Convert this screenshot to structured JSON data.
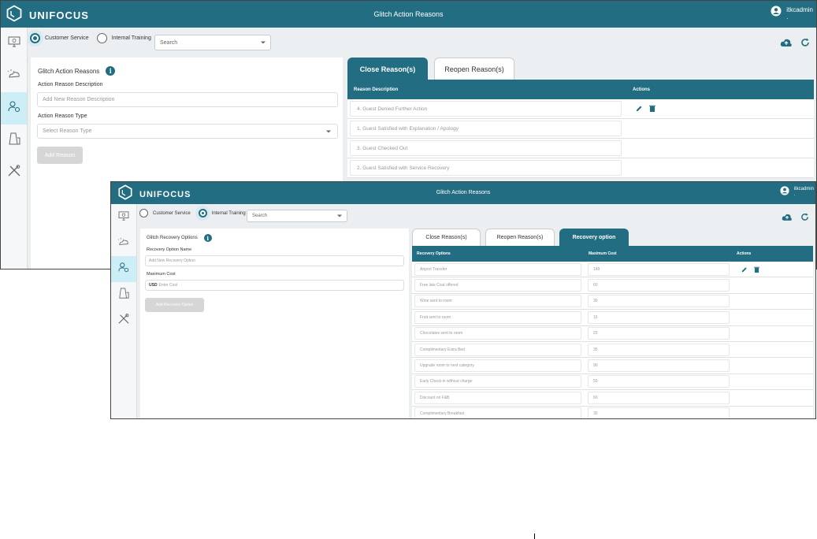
{
  "brand": "UNIFOCUS",
  "colors": {
    "primary": "#236d82",
    "sidebar_active": "#cdeef7",
    "disabled": "#d6d6d6"
  },
  "icons": [
    "unifocus-logo-icon",
    "user-circle-icon",
    "monitor-icon",
    "weather-icon",
    "user-settings-icon",
    "cleaning-icon",
    "tools-icon",
    "cloud-upload-icon",
    "refresh-icon",
    "info-icon",
    "edit-icon",
    "delete-icon",
    "chevron-down-icon"
  ],
  "window1": {
    "title": "Glitch Action Reasons",
    "user": {
      "name": "itkcadmin",
      "sub": "."
    },
    "radios": [
      {
        "label": "Customer Service",
        "selected": true
      },
      {
        "label": "Internal Training",
        "selected": false
      }
    ],
    "search_placeholder": "Search",
    "form": {
      "heading": "Glitch Action Reasons",
      "desc_label": "Action Reason Description",
      "desc_placeholder": "Add New Reason Description",
      "type_label": "Action Reason Type",
      "type_placeholder": "Select Reason Type",
      "add_button": "Add Reason"
    },
    "tabs": [
      {
        "label": "Close Reason(s)",
        "active": true
      },
      {
        "label": "Reopen Reason(s)",
        "active": false
      }
    ],
    "columns": [
      "Reason Description",
      "Actions"
    ],
    "rows": [
      {
        "desc": "4. Guest Denied Further Action"
      },
      {
        "desc": "1. Guest Satisfied with Explanation / Apology"
      },
      {
        "desc": "3. Guest Checked Out"
      },
      {
        "desc": "2. Guest Satisfied with Service Recovery"
      }
    ]
  },
  "window2": {
    "title": "Glitch Action Reasons",
    "user": {
      "name": "itkcadmin",
      "sub": "."
    },
    "radios": [
      {
        "label": "Customer Service",
        "selected": false
      },
      {
        "label": "Internal Training",
        "selected": true
      }
    ],
    "search_placeholder": "Search",
    "form": {
      "heading": "Glitch Recovery Options",
      "name_label": "Recovery Option Name",
      "name_placeholder": "Add New Recovery Option",
      "cost_label": "Maximum Cost",
      "cost_currency": "USD",
      "cost_placeholder": "Enter Cost",
      "add_button": "Add Recovery Option"
    },
    "tabs": [
      {
        "label": "Close Reason(s)",
        "active": false
      },
      {
        "label": "Reopen Reason(s)",
        "active": false
      },
      {
        "label": "Recovery option",
        "active": true
      }
    ],
    "columns": [
      "Recovery Options",
      "Maximum Cost",
      "Actions"
    ],
    "rows": [
      {
        "option": "Airport Transfer",
        "cost": "149"
      },
      {
        "option": "Free late Cout offered",
        "cost": "60"
      },
      {
        "option": "Wine sent to room",
        "cost": "30"
      },
      {
        "option": "Fruit sent to room",
        "cost": "15"
      },
      {
        "option": "Chocolates sent to room",
        "cost": "20"
      },
      {
        "option": "Complimentary Extra Bed",
        "cost": "35"
      },
      {
        "option": "Upgrade room to next category",
        "cost": "90"
      },
      {
        "option": "Early Check-in without charge",
        "cost": "50"
      },
      {
        "option": "Discount on F&B",
        "cost": "60"
      },
      {
        "option": "Complimentary Breakfast",
        "cost": "30"
      }
    ]
  }
}
